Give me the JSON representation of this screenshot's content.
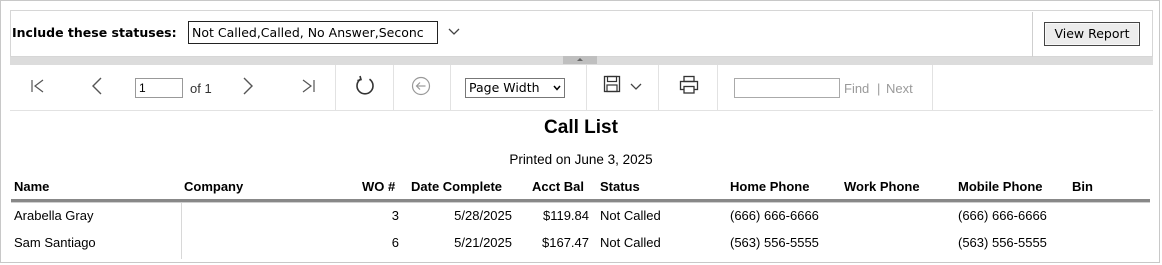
{
  "parameters": {
    "label": "Include these statuses:",
    "value": "Not Called,Called, No Answer,Seconc",
    "view_report_label": "View Report"
  },
  "toolbar": {
    "current_page": "1",
    "of_label": "of 1",
    "zoom": "Page Width",
    "find_value": "",
    "find_label": "Find",
    "find_separator": "|",
    "next_label": "Next"
  },
  "report": {
    "title": "Call List",
    "printed": "Printed on June 3, 2025",
    "columns": [
      "Name",
      "Company",
      "WO #",
      "Date Complete",
      "Acct Bal",
      "Status",
      "Home Phone",
      "Work Phone",
      "Mobile Phone",
      "Bin"
    ],
    "rows": [
      [
        "Arabella Gray",
        "",
        "3",
        "5/28/2025",
        "$119.84",
        "Not Called",
        "(666) 666-6666",
        "",
        "(666) 666-6666",
        ""
      ],
      [
        "Sam Santiago",
        "",
        "6",
        "5/21/2025",
        "$167.47",
        "Not Called",
        "(563) 556-5555",
        "",
        "(563) 556-5555",
        ""
      ]
    ]
  }
}
